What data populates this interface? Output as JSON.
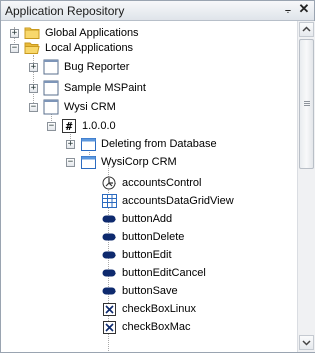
{
  "panel": {
    "title": "Application Repository",
    "pin_glyph": "⨪",
    "close_glyph": "✕"
  },
  "tree": [
    {
      "label": "Global Applications",
      "icon": "folder-icon",
      "expander": "+"
    },
    {
      "label": "Local Applications",
      "icon": "folder-open-icon",
      "expander": "−"
    },
    {
      "label": "Bug Reporter",
      "icon": "window-icon",
      "expander": "+"
    },
    {
      "label": "Sample MSPaint",
      "icon": "window-icon",
      "expander": "+"
    },
    {
      "label": "Wysi CRM",
      "icon": "window-icon",
      "expander": "−"
    },
    {
      "label": "1.0.0.0",
      "icon": "version-icon",
      "expander": "−"
    },
    {
      "label": "Deleting from Database",
      "icon": "form-icon",
      "expander": "+"
    },
    {
      "label": "WysiCorp CRM",
      "icon": "form-icon",
      "expander": "−"
    },
    {
      "label": "accountsControl",
      "icon": "control-icon",
      "expander": ""
    },
    {
      "label": "accountsDataGridView",
      "icon": "grid-icon",
      "expander": ""
    },
    {
      "label": "buttonAdd",
      "icon": "button-icon",
      "expander": ""
    },
    {
      "label": "buttonDelete",
      "icon": "button-icon",
      "expander": ""
    },
    {
      "label": "buttonEdit",
      "icon": "button-icon",
      "expander": ""
    },
    {
      "label": "buttonEditCancel",
      "icon": "button-icon",
      "expander": ""
    },
    {
      "label": "buttonSave",
      "icon": "button-icon",
      "expander": ""
    },
    {
      "label": "checkBoxLinux",
      "icon": "checkbox-icon",
      "expander": ""
    },
    {
      "label": "checkBoxMac",
      "icon": "checkbox-icon",
      "expander": ""
    }
  ],
  "colors": {
    "folder": "#f2c94c",
    "accent": "#2c6bc0"
  }
}
